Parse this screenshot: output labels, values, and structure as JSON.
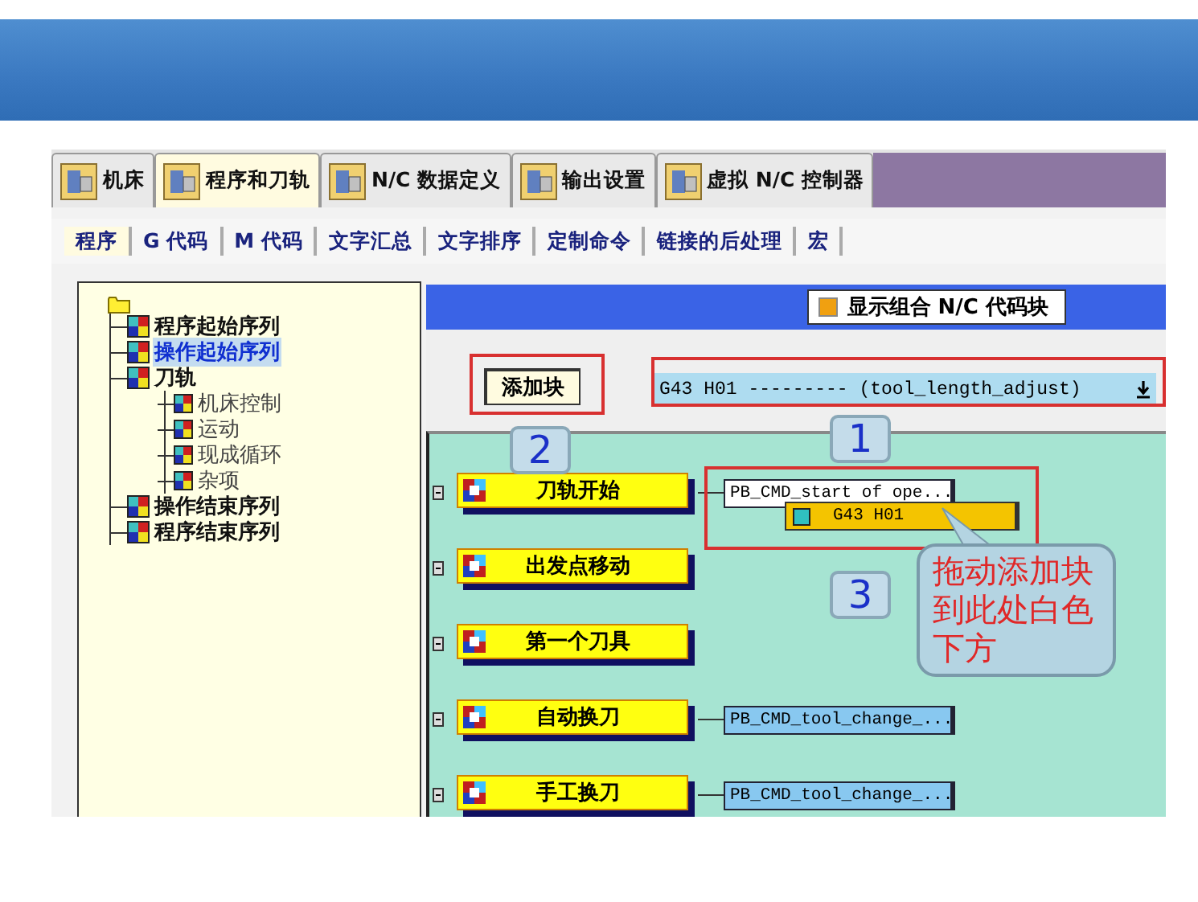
{
  "main_tabs": [
    {
      "label": "机床",
      "selected": false
    },
    {
      "label": "程序和刀轨",
      "selected": true
    },
    {
      "label": "N/C 数据定义",
      "selected": false
    },
    {
      "label": "输出设置",
      "selected": false
    },
    {
      "label": "虚拟 N/C 控制器",
      "selected": false
    }
  ],
  "sub_tabs": [
    {
      "label": "程序",
      "selected": true
    },
    {
      "label": "G 代码",
      "selected": false
    },
    {
      "label": "M 代码",
      "selected": false
    },
    {
      "label": "文字汇总",
      "selected": false
    },
    {
      "label": "文字排序",
      "selected": false
    },
    {
      "label": "定制命令",
      "selected": false
    },
    {
      "label": "链接的后处理",
      "selected": false
    },
    {
      "label": "宏",
      "selected": false
    }
  ],
  "tree": {
    "items": [
      {
        "label": "程序起始序列",
        "selected": false
      },
      {
        "label": "操作起始序列",
        "selected": true
      },
      {
        "label": "刀轨",
        "selected": false,
        "children": [
          {
            "label": "机床控制",
            "selected": false
          },
          {
            "label": "运动",
            "selected": false
          },
          {
            "label": "现成循环",
            "selected": false
          },
          {
            "label": "杂项",
            "selected": false
          }
        ]
      },
      {
        "label": "操作结束序列",
        "selected": false
      },
      {
        "label": "程序结束序列",
        "selected": false
      }
    ]
  },
  "display_combined": {
    "label": "显示组合 N/C 代码块",
    "checked": true
  },
  "add_block_button": "添加块",
  "block_dropdown": {
    "value": "G43 H01 --------- (tool_length_adjust)"
  },
  "events": [
    {
      "label": "刀轨开始",
      "blocks": [
        {
          "label": "PB_CMD_start of ope...",
          "highlighted": true
        }
      ]
    },
    {
      "label": "出发点移动"
    },
    {
      "label": "第一个刀具"
    },
    {
      "label": "自动换刀",
      "blocks": [
        {
          "label": "PB_CMD_tool_change_...",
          "highlighted": false
        }
      ]
    },
    {
      "label": "手工换刀",
      "blocks": [
        {
          "label": "PB_CMD_tool_change_...",
          "highlighted": false
        }
      ]
    }
  ],
  "dragged_block": "G43 H01",
  "step_numbers": [
    "1",
    "2",
    "3"
  ],
  "callout": "拖动添加块到此处白色下方"
}
